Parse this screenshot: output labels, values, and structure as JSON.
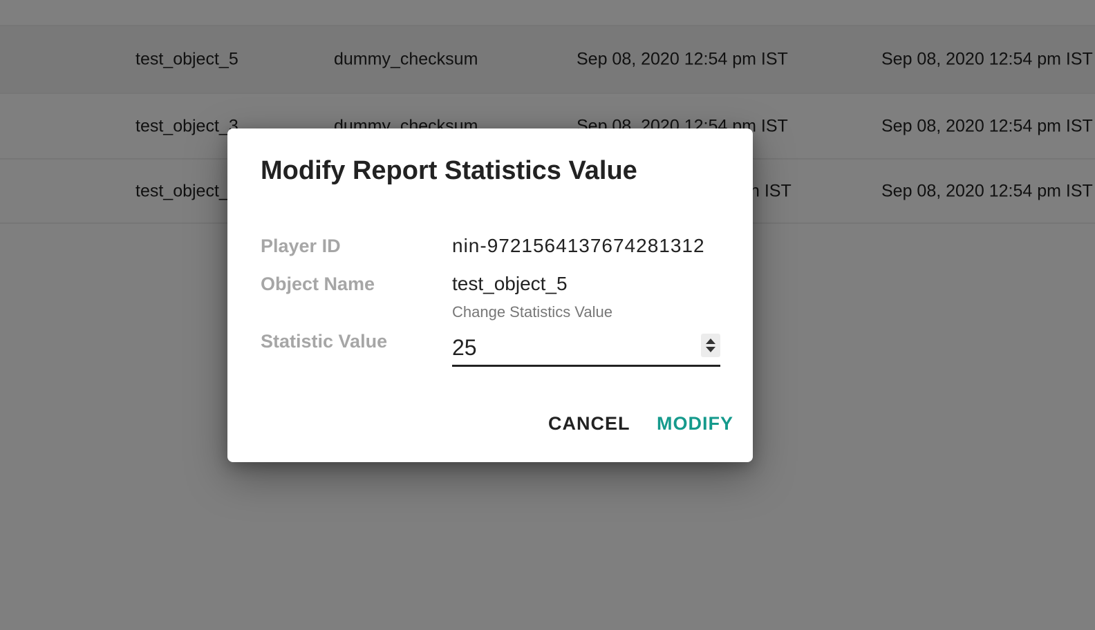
{
  "table": {
    "rows": [
      {
        "name": "test_object_5",
        "checksum": "dummy_checksum",
        "created": "Sep 08, 2020 12:54 pm IST",
        "updated": "Sep 08, 2020 12:54 pm IST"
      },
      {
        "name": "test_object_3",
        "checksum": "dummy_checksum",
        "created": "Sep 08, 2020 12:54 pm IST",
        "updated": "Sep 08, 2020 12:54 pm IST"
      },
      {
        "name": "test_object_",
        "checksum": "",
        "created": "n IST",
        "updated": "Sep 08, 2020 12:54 pm IST"
      }
    ]
  },
  "dialog": {
    "title": "Modify Report Statistics Value",
    "player_id_label": "Player ID",
    "player_id_value": "nin-9721564137674281312",
    "object_name_label": "Object Name",
    "object_name_value": "test_object_5",
    "statistic_value_label": "Statistic Value",
    "input_label": "Change Statistics Value",
    "input_value": "25",
    "cancel_label": "CANCEL",
    "modify_label": "MODIFY"
  },
  "colors": {
    "accent": "#159a8c",
    "overlay": "rgba(0,0,0,0.5)"
  }
}
